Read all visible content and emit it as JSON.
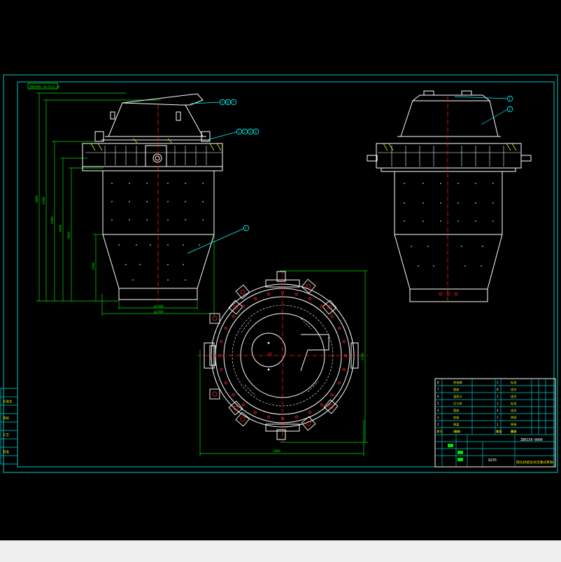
{
  "colors": {
    "background": "#000000",
    "frame": "#00c8c8",
    "outline": "#ffffff",
    "center_line": "#ff2020",
    "dimension": "#00e000",
    "leader": "#00ffff",
    "hatch": "#ffff00"
  },
  "drawing": {
    "top_left_note": "ZB500-4×3×2.0",
    "front_view": {
      "balloons_top": [
        "5",
        "6",
        "7"
      ],
      "balloons_mid": [
        "1",
        "2",
        "3",
        "4"
      ],
      "balloon_body": "1",
      "dims_vertical": [
        "4800",
        "4500",
        "4300",
        "3800",
        "2900",
        "1200"
      ],
      "dims_horizontal": [
        "φ2300",
        "φ2500"
      ]
    },
    "side_view": {
      "balloons": [
        "1",
        "2"
      ]
    },
    "plan_view": {
      "dim_vertical": "2700",
      "dim_horizontal": "2800"
    },
    "title_block": {
      "drawing_number": "ZB0150-0000",
      "title": "硫化机组合式活塞式蒸锅",
      "material": "Q235",
      "rows": [
        {
          "no": "8",
          "name": "热电偶",
          "qty": "2",
          "note": "标准"
        },
        {
          "no": "7",
          "name": "管座",
          "qty": "8",
          "note": "组合"
        },
        {
          "no": "6",
          "name": "温度计",
          "qty": "1",
          "note": "组合"
        },
        {
          "no": "5",
          "name": "压力表",
          "qty": "1",
          "note": "标准"
        },
        {
          "no": "4",
          "name": "管座",
          "qty": "4",
          "note": "组合"
        },
        {
          "no": "3",
          "name": "底座",
          "qty": "1",
          "note": "焊接"
        },
        {
          "no": "2",
          "name": "锅盖",
          "qty": "1",
          "note": "焊接"
        },
        {
          "no": "1",
          "name": "锅体",
          "qty": "1",
          "note": "焊接"
        }
      ],
      "footer": [
        "序号",
        "名称",
        "数量",
        "备注"
      ]
    },
    "left_strip": [
      "标准化",
      "审核",
      "工艺",
      "批准"
    ]
  }
}
